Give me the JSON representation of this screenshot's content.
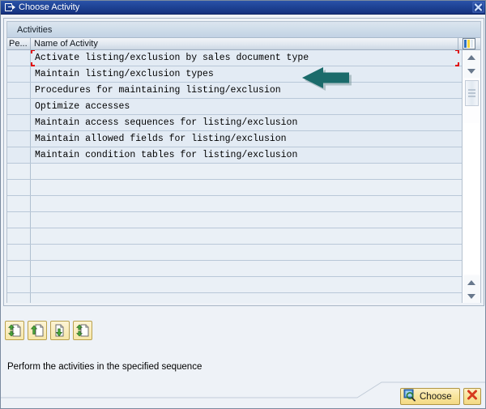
{
  "window": {
    "title": "Choose Activity",
    "title_icon": "transaction-exit-icon",
    "close_icon": "close-icon"
  },
  "group": {
    "label": "Activities"
  },
  "table": {
    "columns": [
      {
        "key": "performed",
        "label": "Pe..."
      },
      {
        "key": "name",
        "label": "Name of Activity"
      }
    ],
    "config_icon": "table-settings-icon",
    "rows": [
      {
        "performed": "",
        "name": "Activate listing/exclusion by sales document type",
        "selected": true
      },
      {
        "performed": "",
        "name": "Maintain listing/exclusion types",
        "selected": false
      },
      {
        "performed": "",
        "name": "Procedures for maintaining listing/exclusion",
        "selected": false
      },
      {
        "performed": "",
        "name": "Optimize accesses",
        "selected": false
      },
      {
        "performed": "",
        "name": "Maintain access sequences for listing/exclusion",
        "selected": false
      },
      {
        "performed": "",
        "name": "Maintain allowed fields for listing/exclusion",
        "selected": false
      },
      {
        "performed": "",
        "name": "Maintain condition tables for listing/exclusion",
        "selected": false
      },
      {
        "performed": "",
        "name": "",
        "selected": false
      },
      {
        "performed": "",
        "name": "",
        "selected": false
      },
      {
        "performed": "",
        "name": "",
        "selected": false
      },
      {
        "performed": "",
        "name": "",
        "selected": false
      },
      {
        "performed": "",
        "name": "",
        "selected": false
      },
      {
        "performed": "",
        "name": "",
        "selected": false
      },
      {
        "performed": "",
        "name": "",
        "selected": false
      },
      {
        "performed": "",
        "name": "",
        "selected": false
      },
      {
        "performed": "",
        "name": "",
        "selected": false
      }
    ]
  },
  "scrollbar": {
    "up_icon": "scroll-up-icon",
    "down_icon": "scroll-down-icon",
    "thumb_icon": "scroll-thumb-grip"
  },
  "navigation": {
    "buttons": [
      {
        "name": "first-page-button",
        "icon": "first-page-icon"
      },
      {
        "name": "previous-page-button",
        "icon": "previous-page-icon"
      },
      {
        "name": "next-page-button",
        "icon": "next-page-icon"
      },
      {
        "name": "last-page-button",
        "icon": "last-page-icon"
      }
    ]
  },
  "status": {
    "text": "Perform the activities in the specified sequence"
  },
  "actions": {
    "choose_label": "Choose",
    "choose_icon": "magnifier-icon",
    "cancel_icon": "cancel-x-icon"
  },
  "annotation": {
    "arrow_icon": "pointer-arrow-left-icon",
    "arrow_color": "#1b6b6b"
  },
  "colors": {
    "titlebar": "#1f4496",
    "row_fill": "#e3ebf4",
    "row_empty": "#eaf0f6",
    "selection_marker": "#e00000",
    "button_yellow": "#f8e49c",
    "accent_teal": "#1b6b6b"
  }
}
